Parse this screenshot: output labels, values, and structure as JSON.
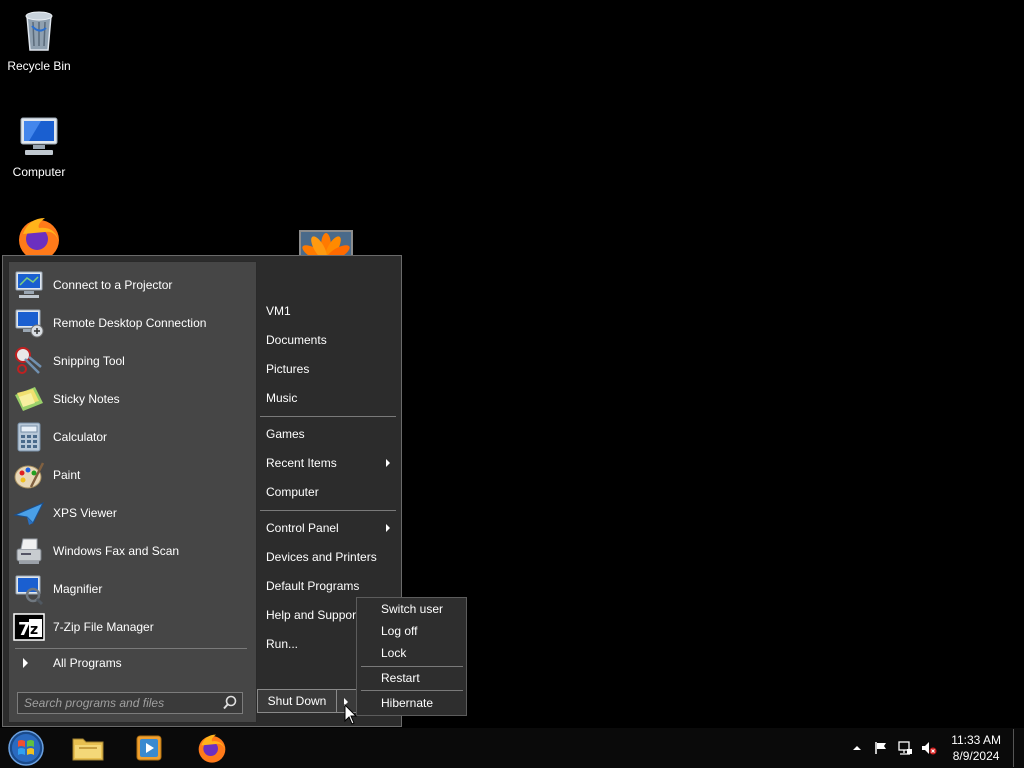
{
  "desktop": {
    "icons": [
      {
        "label": "Recycle Bin",
        "icon": "recycle-bin-icon"
      },
      {
        "label": "Computer",
        "icon": "computer-icon"
      },
      {
        "label": "",
        "icon": "firefox-icon"
      }
    ]
  },
  "start_menu": {
    "programs": [
      {
        "label": "Connect to a Projector",
        "icon": "projector-icon"
      },
      {
        "label": "Remote Desktop Connection",
        "icon": "remote-desktop-icon"
      },
      {
        "label": "Snipping Tool",
        "icon": "snipping-tool-icon"
      },
      {
        "label": "Sticky Notes",
        "icon": "sticky-notes-icon"
      },
      {
        "label": "Calculator",
        "icon": "calculator-icon"
      },
      {
        "label": "Paint",
        "icon": "paint-icon"
      },
      {
        "label": "XPS Viewer",
        "icon": "xps-viewer-icon"
      },
      {
        "label": "Windows Fax and Scan",
        "icon": "fax-scan-icon"
      },
      {
        "label": "Magnifier",
        "icon": "magnifier-icon"
      },
      {
        "label": "7-Zip File Manager",
        "icon": "7zip-icon"
      }
    ],
    "all_programs": "All Programs",
    "search_placeholder": "Search programs and files",
    "right": {
      "items": [
        {
          "label": "VM1"
        },
        {
          "label": "Documents"
        },
        {
          "label": "Pictures"
        },
        {
          "label": "Music"
        },
        {
          "label": "Games"
        },
        {
          "label": "Recent Items",
          "submenu": true
        },
        {
          "label": "Computer"
        },
        {
          "label": "Control Panel",
          "submenu": true
        },
        {
          "label": "Devices and Printers"
        },
        {
          "label": "Default Programs"
        },
        {
          "label": "Help and Support"
        },
        {
          "label": "Run..."
        }
      ]
    },
    "shutdown_label": "Shut Down"
  },
  "shutdown_submenu": {
    "items": [
      "Switch user",
      "Log off",
      "Lock",
      "Restart",
      "Hibernate"
    ]
  },
  "taskbar": {
    "pinned": [
      "explorer-icon",
      "media-player-icon",
      "firefox-icon"
    ],
    "clock_time": "11:33 AM",
    "clock_date": "8/9/2024"
  },
  "colors": {
    "menu_bg": "#2c2c2c",
    "left_pane_bg": "#464646",
    "taskbar_bg": "#0a0a0a"
  }
}
